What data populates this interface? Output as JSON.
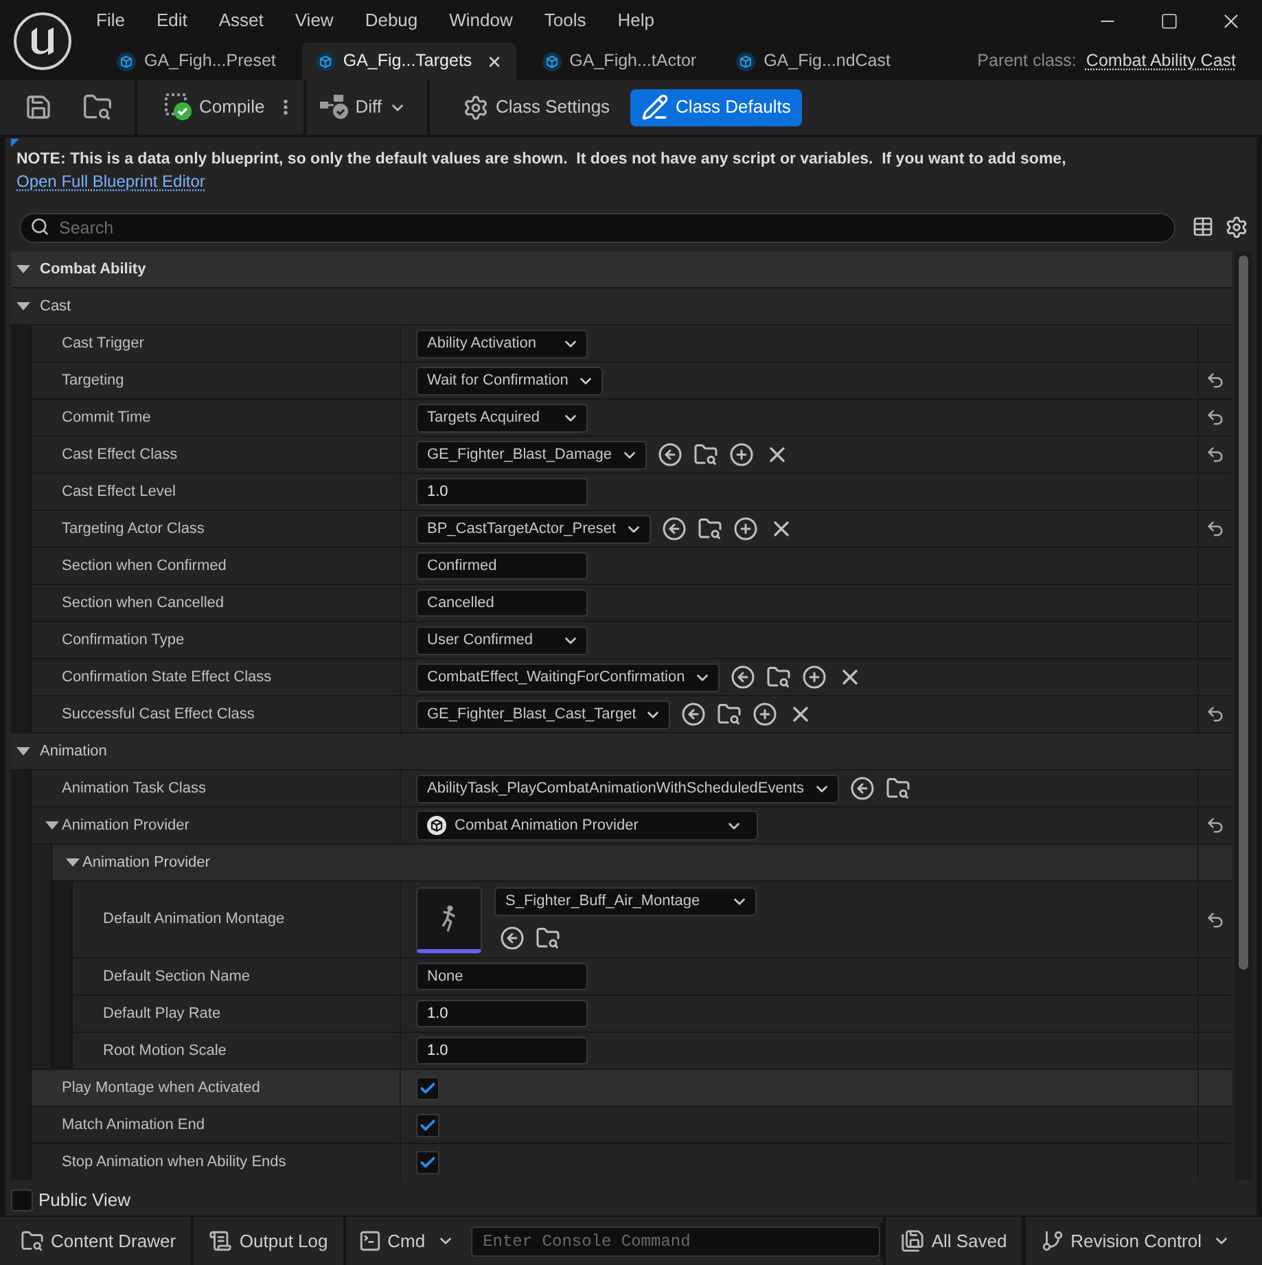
{
  "window": {
    "menu": [
      {
        "label": "File"
      },
      {
        "label": "Edit"
      },
      {
        "label": "Asset"
      },
      {
        "label": "View"
      },
      {
        "label": "Debug"
      },
      {
        "label": "Window"
      },
      {
        "label": "Tools"
      },
      {
        "label": "Help"
      }
    ],
    "controls": [
      {
        "kind": "minimize"
      },
      {
        "kind": "maximize"
      },
      {
        "kind": "close"
      }
    ]
  },
  "tabs": [
    {
      "label": "GA_Figh...Preset",
      "selected": false
    },
    {
      "label": "GA_Fig...Targets",
      "selected": true
    },
    {
      "label": "GA_Figh...tActor",
      "selected": false
    },
    {
      "label": "GA_Fig...ndCast",
      "selected": false
    }
  ],
  "parent_class": {
    "label": "Parent class:",
    "value": "Combat Ability Cast"
  },
  "toolbar": {
    "groups": [
      [
        {
          "kind": "save"
        },
        {
          "kind": "browse"
        }
      ],
      [
        {
          "kind": "compile",
          "label": "Compile"
        },
        {
          "kind": "options"
        }
      ],
      [
        {
          "kind": "diff",
          "label": "Diff"
        }
      ]
    ],
    "modes": [
      {
        "kind": "settings",
        "label": "Class Settings",
        "selected": false
      },
      {
        "kind": "defaults",
        "label": "Class Defaults",
        "selected": true
      }
    ]
  },
  "note": {
    "text": "NOTE: This is a data only blueprint, so only the default values are shown.  It does not have any script or variables.  If you want to add some,",
    "link": "Open Full Blueprint Editor"
  },
  "search": {
    "placeholder": "Search"
  },
  "details": [
    {
      "kind": "category",
      "label": "Combat Ability",
      "expanded": true,
      "children": [
        {
          "kind": "category",
          "label": "Cast",
          "expanded": true,
          "children": [
            {
              "kind": "combo",
              "label": "Cast Trigger",
              "value": "Ability Activation",
              "modified": false,
              "highlighted": false
            },
            {
              "kind": "combo",
              "label": "Targeting",
              "value": "Wait for Confirmation",
              "modified": true,
              "highlighted": false
            },
            {
              "kind": "combo",
              "label": "Commit Time",
              "value": "Targets Acquired",
              "modified": true,
              "highlighted": false
            },
            {
              "kind": "class",
              "label": "Cast Effect Class",
              "value": "GE_Fighter_Blast_Damage",
              "actions": [
                {
                  "kind": "use"
                },
                {
                  "kind": "browse"
                },
                {
                  "kind": "create"
                },
                {
                  "kind": "clear"
                }
              ],
              "modified": true,
              "highlighted": false
            },
            {
              "kind": "number",
              "label": "Cast Effect Level",
              "value": "1.0",
              "modified": false,
              "highlighted": false
            },
            {
              "kind": "class",
              "label": "Targeting Actor Class",
              "value": "BP_CastTargetActor_Preset",
              "actions": [
                {
                  "kind": "use"
                },
                {
                  "kind": "browse"
                },
                {
                  "kind": "create"
                },
                {
                  "kind": "clear"
                }
              ],
              "modified": true,
              "highlighted": false
            },
            {
              "kind": "text",
              "label": "Section when Confirmed",
              "value": "Confirmed",
              "modified": false,
              "highlighted": false
            },
            {
              "kind": "text",
              "label": "Section when Cancelled",
              "value": "Cancelled",
              "modified": false,
              "highlighted": false
            },
            {
              "kind": "combo",
              "label": "Confirmation Type",
              "value": "User Confirmed",
              "modified": false,
              "highlighted": false
            },
            {
              "kind": "class",
              "label": "Confirmation State Effect Class",
              "value": "CombatEffect_WaitingForConfirmation",
              "actions": [
                {
                  "kind": "use"
                },
                {
                  "kind": "browse"
                },
                {
                  "kind": "create"
                },
                {
                  "kind": "clear"
                }
              ],
              "modified": false,
              "highlighted": false
            },
            {
              "kind": "class",
              "label": "Successful Cast Effect Class",
              "value": "GE_Fighter_Blast_Cast_Target",
              "actions": [
                {
                  "kind": "use"
                },
                {
                  "kind": "browse"
                },
                {
                  "kind": "create"
                },
                {
                  "kind": "clear"
                }
              ],
              "modified": true,
              "highlighted": false
            }
          ]
        },
        {
          "kind": "category",
          "label": "Animation",
          "expanded": true,
          "children": [
            {
              "kind": "class",
              "label": "Animation Task Class",
              "value": "AbilityTask_PlayCombatAnimationWithScheduledEvents",
              "actions": [
                {
                  "kind": "use"
                },
                {
                  "kind": "browse"
                }
              ],
              "modified": false,
              "highlighted": false
            },
            {
              "kind": "struct",
              "label": "Animation Provider",
              "value": "Combat Animation Provider",
              "expanded": true,
              "modified": true,
              "highlighted": false,
              "children": [
                {
                  "kind": "group",
                  "label": "Animation Provider",
                  "expanded": true,
                  "children": [
                    {
                      "kind": "asset",
                      "label": "Default Animation Montage",
                      "value": "S_Fighter_Buff_Air_Montage",
                      "actions": [
                        {
                          "kind": "use"
                        },
                        {
                          "kind": "browse"
                        }
                      ],
                      "modified": true,
                      "highlighted": false
                    },
                    {
                      "kind": "text",
                      "label": "Default Section Name",
                      "value": "None",
                      "modified": false,
                      "highlighted": false
                    },
                    {
                      "kind": "number",
                      "label": "Default Play Rate",
                      "value": "1.0",
                      "modified": false,
                      "highlighted": false
                    },
                    {
                      "kind": "number",
                      "label": "Root Motion Scale",
                      "value": "1.0",
                      "modified": false,
                      "highlighted": false
                    }
                  ]
                }
              ]
            },
            {
              "kind": "check",
              "label": "Play Montage when Activated",
              "checked": true,
              "modified": false,
              "highlighted": true
            },
            {
              "kind": "check",
              "label": "Match Animation End",
              "checked": true,
              "modified": false,
              "highlighted": false
            },
            {
              "kind": "check",
              "label": "Stop Animation when Ability Ends",
              "checked": true,
              "modified": false,
              "highlighted": false
            }
          ]
        }
      ]
    }
  ],
  "public_view": {
    "label": "Public View",
    "checked": false
  },
  "status_bar": {
    "left": [
      {
        "kind": "drawer",
        "label": "Content Drawer"
      },
      {
        "kind": "log",
        "label": "Output Log"
      }
    ],
    "cmd": {
      "label": "Cmd"
    },
    "console": {
      "placeholder": "Enter Console Command"
    },
    "right": [
      {
        "kind": "saved",
        "label": "All Saved"
      },
      {
        "kind": "revision",
        "label": "Revision Control"
      }
    ]
  }
}
